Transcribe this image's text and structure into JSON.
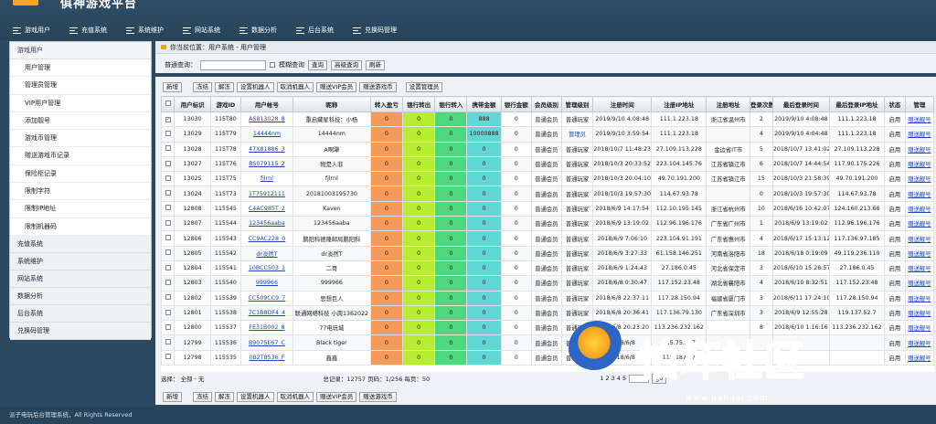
{
  "header": {
    "title": "俱神游戏平台"
  },
  "topnav": [
    "游戏用户",
    "充值系统",
    "系统维护",
    "网站系统",
    "数据分析",
    "后台系统",
    "兑换码管理"
  ],
  "sidebar": {
    "group_user": "游戏用户",
    "items": [
      "用户管理",
      "管理员管理",
      "VIP用户管理",
      "添加靓号",
      "游戏币管理",
      "赠送游戏币记录",
      "保险柜记录",
      "限制字符",
      "限制IP地址",
      "限制机器码"
    ],
    "groups": [
      "充值系统",
      "系统维护",
      "网站系统",
      "数据分析",
      "后台系统",
      "兑换码管理"
    ]
  },
  "breadcrumb": "你当前位置：用户系统 - 用户管理",
  "search": {
    "label": "普通查询：",
    "value": "",
    "fuzzy": "模糊查询",
    "btn_query": "查询",
    "btn_adv": "高级查询",
    "btn_refresh": "刷新"
  },
  "toolbar": {
    "new": "新增",
    "freeze": "冻结",
    "unfreeze": "解冻",
    "set_robot": "设置机器人",
    "cancel_robot": "取消机器人",
    "gift_vip": "赠送VIP会员",
    "gift_coin": "赠送游戏币",
    "set_admin": "设置管理员"
  },
  "columns": [
    "用户标识",
    "游戏ID",
    "用户帐号",
    "昵称",
    "转入盈亏",
    "银行转出",
    "银行转入",
    "携带金额",
    "银行金额",
    "会员级别",
    "管理级别",
    "注册时间",
    "注册IP地址",
    "注册地址",
    "登录次数",
    "最后登录时间",
    "最后登录IP地址",
    "状态",
    "管理"
  ],
  "rows": [
    [
      "13030",
      "115T80",
      "AS813028_8",
      "重启藏星科技：小杨",
      "0",
      "0",
      "0",
      "888",
      "0",
      "普通会员",
      "普通玩家",
      "2019/9/10 4:08:48",
      "111.1.223.18",
      "浙江省温州市",
      "2",
      "2019/9/10 4:08:48",
      "111.1.223.18",
      "启用",
      "赠送靓号"
    ],
    [
      "13029",
      "115T79",
      "14444nm",
      "14444nm",
      "0",
      "0",
      "0",
      "10000888",
      "0",
      "普通会员",
      "管理员",
      "2019/9/10 3:59:54",
      "111.1.223.18",
      "",
      "4",
      "2019/9/10 4:04:48",
      "111.1.223.18",
      "启用",
      "赠送靓号"
    ],
    [
      "13028",
      "115T78",
      "47X81886_3",
      "A啊犟",
      "0",
      "0",
      "0",
      "0",
      "0",
      "普通会员",
      "普通玩家",
      "2018/10/7 11:48:23",
      "27.109.113.228",
      "金边省IT市",
      "5",
      "2018/10/7 13:41:02",
      "27.109.113.228",
      "启用",
      "赠送靓号"
    ],
    [
      "13027",
      "115T76",
      "BS079115_2",
      "物是人非",
      "0",
      "0",
      "0",
      "0",
      "0",
      "普通会员",
      "普通玩家",
      "2018/10/3 20:33:52",
      "223.104.145.76",
      "江苏省镇江市",
      "6",
      "2018/10/7 14:44:54",
      "117.90.175.226",
      "启用",
      "赠送靓号"
    ],
    [
      "13025",
      "115T75",
      "fjlrnl",
      "fjlrnl",
      "0",
      "0",
      "0",
      "0",
      "0",
      "普通会员",
      "普通玩家",
      "2018/10/3 20:04:10",
      "49.70.191.200",
      "江苏省镇江市",
      "15",
      "2018/10/3 21:58:39",
      "49.70.191.200",
      "启用",
      "赠送靓号"
    ],
    [
      "13024",
      "115T73",
      "1T75912111",
      "20181003195730",
      "0",
      "0",
      "0",
      "0",
      "0",
      "普通会员",
      "普通玩家",
      "2018/10/3 19:57:30",
      "114.67.93.78",
      "",
      "0",
      "2018/10/3 19:57:30",
      "114.67.93.78",
      "启用",
      "赠送靓号"
    ],
    [
      "12808",
      "115545",
      "C4AC985T_2",
      "Kaven",
      "0",
      "0",
      "0",
      "0",
      "0",
      "普通会员",
      "普通玩家",
      "2018/6/9 14:17:54",
      "112.10.195.145",
      "浙江省杭州市",
      "10",
      "2018/6/16 10:42:07",
      "124.160.213.66",
      "启用",
      "赠送靓号"
    ],
    [
      "12807",
      "115544",
      "123456aaba",
      "123456aaba",
      "0",
      "0",
      "0",
      "0",
      "0",
      "普通会员",
      "普通玩家",
      "2018/6/9 13:19:02",
      "112.96.196.176",
      "广东省广州市",
      "1",
      "2018/6/9 13:19:02",
      "112.96.196.176",
      "启用",
      "赠送靓号"
    ],
    [
      "12806",
      "115543",
      "CC9AC228_0",
      "鹏阳科德隆邮局鹏阳科",
      "0",
      "0",
      "0",
      "0",
      "0",
      "普通会员",
      "普通玩家",
      "2018/6/9 7:06:10",
      "223.104.91.191",
      "广东省惠州市",
      "4",
      "2018/6/17 15:13:12",
      "117.136.97.185",
      "启用",
      "赠送靓号"
    ],
    [
      "12805",
      "115542",
      "dr淡然T",
      "dr淡然T",
      "0",
      "0",
      "0",
      "0",
      "0",
      "普通会员",
      "普通玩家",
      "2018/6/9 3:27:33",
      "61.158.146.251",
      "河南省洛阳市",
      "18",
      "2018/6/18 0:19:09",
      "49.119.236.110",
      "启用",
      "赠送靓号"
    ],
    [
      "12804",
      "115541",
      "10BCC503_1",
      "二哥",
      "0",
      "0",
      "0",
      "0",
      "0",
      "普通会员",
      "普通玩家",
      "2018/6/9 1:24:43",
      "27.186.0.45",
      "河北省保定市",
      "3",
      "2018/6/10 15:28:57",
      "27.186.0.45",
      "启用",
      "赠送靓号"
    ],
    [
      "12803",
      "115540",
      "999966",
      "999966",
      "0",
      "0",
      "0",
      "0",
      "0",
      "普通会员",
      "普通玩家",
      "2018/6/8 0:30:47",
      "117.152.23.48",
      "湖北省襄阳市",
      "4",
      "2018/6/10 8:32:51",
      "117.152.23.48",
      "启用",
      "赠送靓号"
    ],
    [
      "12802",
      "115539",
      "CC509CC9_7",
      "思想巨人",
      "0",
      "0",
      "0",
      "0",
      "0",
      "普通会员",
      "普通玩家",
      "2018/6/8 22:37:11",
      "117.28.150.94",
      "福建省厦门市",
      "3",
      "2018/6/11 17:24:10",
      "117.28.150.94",
      "启用",
      "赠送靓号"
    ],
    [
      "12801",
      "115538",
      "7C1B8DF4_4",
      "联通网络科技 小周1362022",
      "0",
      "0",
      "0",
      "0",
      "0",
      "普通会员",
      "普通玩家",
      "2018/6/8 20:36:41",
      "117.136.79.130",
      "广东省深圳市",
      "3",
      "2018/6/9 12:55:28",
      "119.137.52.7",
      "启用",
      "赠送靓号"
    ],
    [
      "12800",
      "115537",
      "FE31B002_8",
      "77电玩城",
      "0",
      "0",
      "0",
      "0",
      "0",
      "普通会员",
      "普通玩家",
      "2018/6/8 20:23:20",
      "113.236.232.162",
      "",
      "8",
      "2018/6/10 1:16:16",
      "113.236.232.162",
      "启用",
      "赠送靓号"
    ],
    [
      "12799",
      "115536",
      "B9075E67_C",
      "Black tiger",
      "0",
      "0",
      "0",
      "0",
      "0",
      "普通会员",
      "普通玩家",
      "2018/6/8",
      "115.75.197",
      "",
      "",
      "",
      "",
      "启用",
      "赠送靓号"
    ],
    [
      "12798",
      "115535",
      "0B2T8536_F",
      "鑫鑫",
      "0",
      "0",
      "0",
      "0",
      "0",
      "普通会员",
      "普通玩家",
      "2018/6/8",
      "115.187.77",
      "",
      "",
      "",
      "",
      "启用",
      "赠送靓号"
    ]
  ],
  "footer": {
    "select": "选择：",
    "all": "全部",
    "none": "无",
    "stats": "总记录：12757  页码：1/256  每页：50",
    "pager": "1 2 3 4 5",
    "go": "go"
  },
  "copyright": "派子电玩后台管理系统，All Rights Reserved",
  "watermark": {
    "text": "怕坏社区",
    "url": "www.pahuai.com"
  }
}
